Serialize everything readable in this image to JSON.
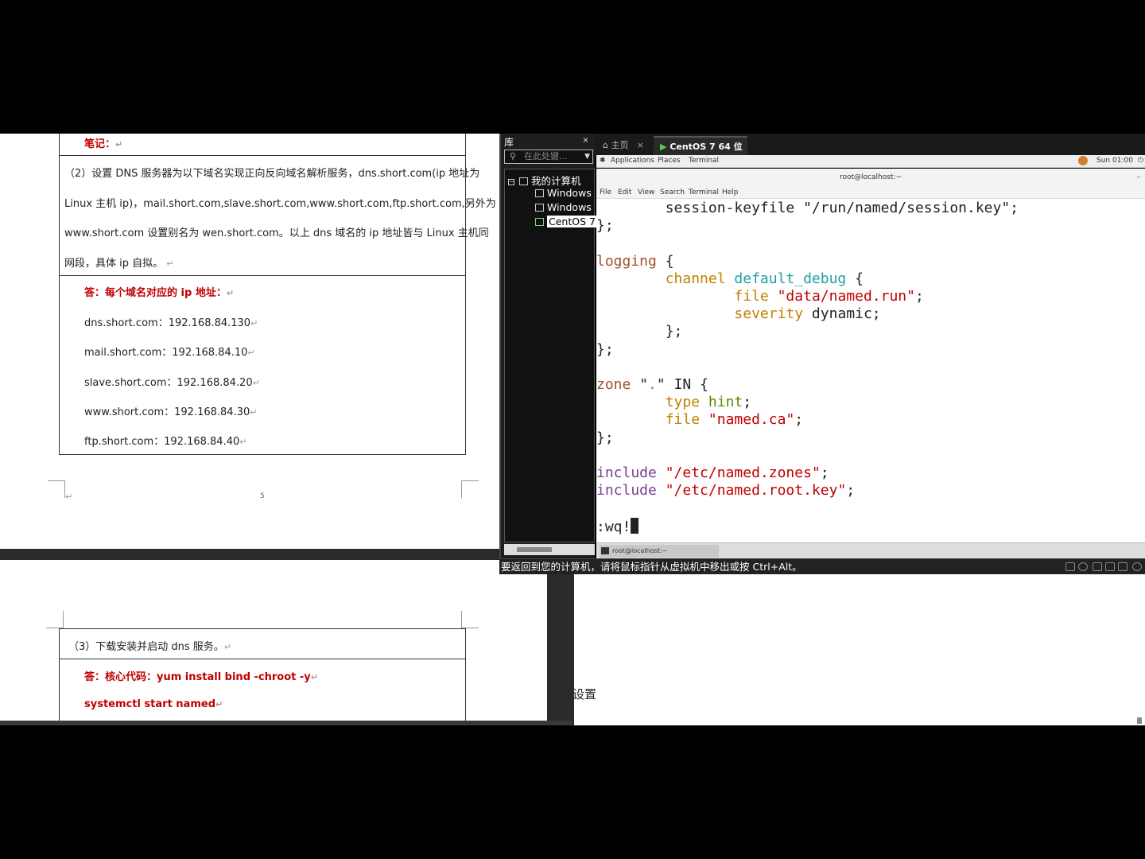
{
  "document": {
    "note_label": "笔记：",
    "question2": {
      "line1": "（2）设置 DNS 服务器为以下域名实现正向反向域名解析服务，dns.short.com(ip 地址为",
      "line2": "Linux 主机 ip)，mail.short.com,slave.short.com,www.short.com,ftp.short.com,另外为",
      "line3": "www.short.com 设置别名为 wen.short.com。以上 dns 域名的 ip 地址皆与 Linux 主机同",
      "line4": "网段，具体 ip 自拟。"
    },
    "answer2": {
      "label": "答：每个域名对应的 ip 地址：",
      "records": [
        "dns.short.com：192.168.84.130",
        "mail.short.com：192.168.84.10",
        "slave.short.com：192.168.84.20",
        "www.short.com：192.168.84.30",
        "ftp.short.com：192.168.84.40"
      ]
    },
    "page_number": "5",
    "question3": "（3）下载安装并启动 dns 服务。",
    "answer3": {
      "line1": "答：核心代码：yum install bind -chroot -y",
      "line2": "systemctl start named"
    },
    "side_text": "设置"
  },
  "library": {
    "title": "库",
    "close": "×",
    "search_placeholder": "在此处键...",
    "tree": {
      "root": "我的计算机",
      "items": [
        "Windows",
        "Windows",
        "CentOS 7"
      ]
    }
  },
  "vm_tabs": {
    "home": "主页",
    "active": "CentOS 7 64 位"
  },
  "gnome": {
    "applications": "Applications",
    "places": "Places",
    "terminal": "Terminal",
    "clock": "Sun 01:00"
  },
  "terminal": {
    "title": "root@localhost:~",
    "menu": [
      "File",
      "Edit",
      "View",
      "Search",
      "Terminal",
      "Help"
    ],
    "taskbar_item": "root@localhost:~",
    "code": {
      "l1": "        session-keyfile \"/run/named/session.key\";",
      "l2": "};",
      "l4a": "logging",
      "l4b": " {",
      "l5a": "        channel ",
      "l5b": "default_debug",
      "l5c": " {",
      "l6a": "                ",
      "l6b": "file",
      "l6c": " ",
      "l6d": "\"data/named.run\"",
      "l6e": ";",
      "l7a": "                ",
      "l7b": "severity",
      "l7c": " dynamic;",
      "l8": "        };",
      "l9": "};",
      "l11a": "zone",
      "l11b": " \"",
      "l11c": ".",
      "l11d": "\" IN {",
      "l12a": "        ",
      "l12b": "type",
      "l12c": " ",
      "l12d": "hint",
      "l12e": ";",
      "l13a": "        ",
      "l13b": "file",
      "l13c": " ",
      "l13d": "\"named.ca\"",
      "l13e": ";",
      "l14": "};",
      "l16a": "include",
      "l16b": " ",
      "l16c": "\"/etc/named.zones\"",
      "l16d": ";",
      "l17a": "include",
      "l17b": " ",
      "l17c": "\"/etc/named.root.key\"",
      "l17d": ";",
      "l19": ":wq!"
    }
  },
  "status_bar": {
    "message": "要返回到您的计算机，请将鼠标指针从虚拟机中移出或按 Ctrl+Alt。"
  },
  "colors": {
    "keyword": "#a0522d",
    "identifier": "#20a0a0",
    "string": "#c00000",
    "option": "#c08000",
    "value": "#5a8a00",
    "include": "#7b3f8f"
  }
}
